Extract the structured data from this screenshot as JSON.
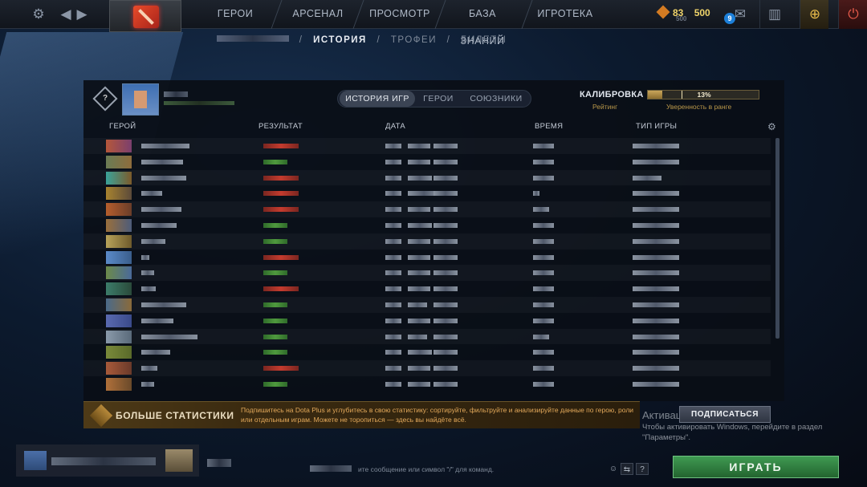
{
  "topbar": {
    "nav": [
      "ГЕРОИ",
      "АРСЕНАЛ",
      "ПРОСМОТР",
      "БАЗА ЗНАНИЙ",
      "ИГРОТЕКА"
    ],
    "shards": "83",
    "shards_sub": "500",
    "gold": "500",
    "notif_count": "9"
  },
  "breadcrumb": {
    "items": [
      "ИСТОРИЯ",
      "ТРОФЕИ",
      "БИЛЕТЫ"
    ],
    "separator": "/"
  },
  "profile": {
    "tabs": [
      "ИСТОРИЯ ИГР",
      "ГЕРОИ",
      "СОЮЗНИКИ"
    ],
    "calibration_label": "КАЛИБРОВКА",
    "confidence_value": 0.13,
    "confidence_text": "13%",
    "rating_label": "Рейтинг",
    "confidence_label": "Уверенность в ранге",
    "rank_icon": "?"
  },
  "table": {
    "columns": [
      "ГЕРОЙ",
      "РЕЗУЛЬТАТ",
      "ДАТА",
      "ВРЕМЯ",
      "ТИП ИГРЫ"
    ],
    "results": [
      "l",
      "w",
      "l",
      "l",
      "l",
      "w",
      "w",
      "l",
      "w",
      "l",
      "w",
      "w",
      "w",
      "w",
      "l",
      "w"
    ],
    "hero_colors": [
      [
        "#b5573a",
        "#7b3f6e"
      ],
      [
        "#6a7c55",
        "#8e6c3c"
      ],
      [
        "#3aa39a",
        "#7c5a2a"
      ],
      [
        "#a8832f",
        "#5b4a3a"
      ],
      [
        "#b65e2c",
        "#6a3d2a"
      ],
      [
        "#9a6f3c",
        "#4d5c7a"
      ],
      [
        "#b8a35a",
        "#6e5a2c"
      ],
      [
        "#5b8ac9",
        "#3a5e8c"
      ],
      [
        "#6c8a4a",
        "#4a6a9a"
      ],
      [
        "#3c7c6a",
        "#2a4a3a"
      ],
      [
        "#4a6a8a",
        "#8a6a3a"
      ],
      [
        "#5a6ab0",
        "#3a4a8a"
      ],
      [
        "#8a9aaa",
        "#5a6a7a"
      ],
      [
        "#7a8a3a",
        "#5a6a2a"
      ],
      [
        "#a85a3a",
        "#6a3a2a"
      ],
      [
        "#b0703a",
        "#6a4a2a"
      ]
    ],
    "hero_name_lengths": [
      60,
      52,
      56,
      26,
      50,
      44,
      30,
      10,
      16,
      18,
      56,
      40,
      70,
      36,
      20,
      16
    ],
    "date_lengths": [
      [
        20,
        28
      ],
      [
        20,
        28
      ],
      [
        20,
        30
      ],
      [
        20,
        40
      ],
      [
        20,
        28
      ],
      [
        20,
        30
      ],
      [
        20,
        28
      ],
      [
        20,
        28
      ],
      [
        20,
        28
      ],
      [
        20,
        28
      ],
      [
        20,
        24
      ],
      [
        20,
        28
      ],
      [
        20,
        24
      ],
      [
        20,
        30
      ],
      [
        20,
        28
      ],
      [
        20,
        28
      ]
    ],
    "time_lengths": [
      26,
      26,
      26,
      8,
      20,
      26,
      26,
      26,
      26,
      26,
      26,
      26,
      20,
      26,
      26,
      26
    ],
    "type_lengths": [
      58,
      58,
      36,
      58,
      58,
      58,
      58,
      58,
      58,
      58,
      58,
      58,
      58,
      58,
      58,
      58
    ]
  },
  "plus": {
    "title": "БОЛЬШЕ СТАТИСТИКИ",
    "text": "Подпишитесь на Dota Plus и углубитесь в свою статистику: сортируйте, фильтруйте и анализируйте данные по герою, роли или отдельным играм. Можете не торопиться — здесь вы найдёте всё.",
    "button": "ПОДПИСАТЬСЯ"
  },
  "windows": {
    "title": "Активаци",
    "subtitle": "Чтобы активировать Windows, перейдите в раздел \"Параметры\"."
  },
  "chat": {
    "placeholder": "ите сообщение или символ \"/\" для команд."
  },
  "play_button": "ИГРАТЬ",
  "colors": {
    "win": "#4f9a3e",
    "loss": "#c43b2e",
    "play": "#3f9a52",
    "gold": "#f0d46a"
  }
}
